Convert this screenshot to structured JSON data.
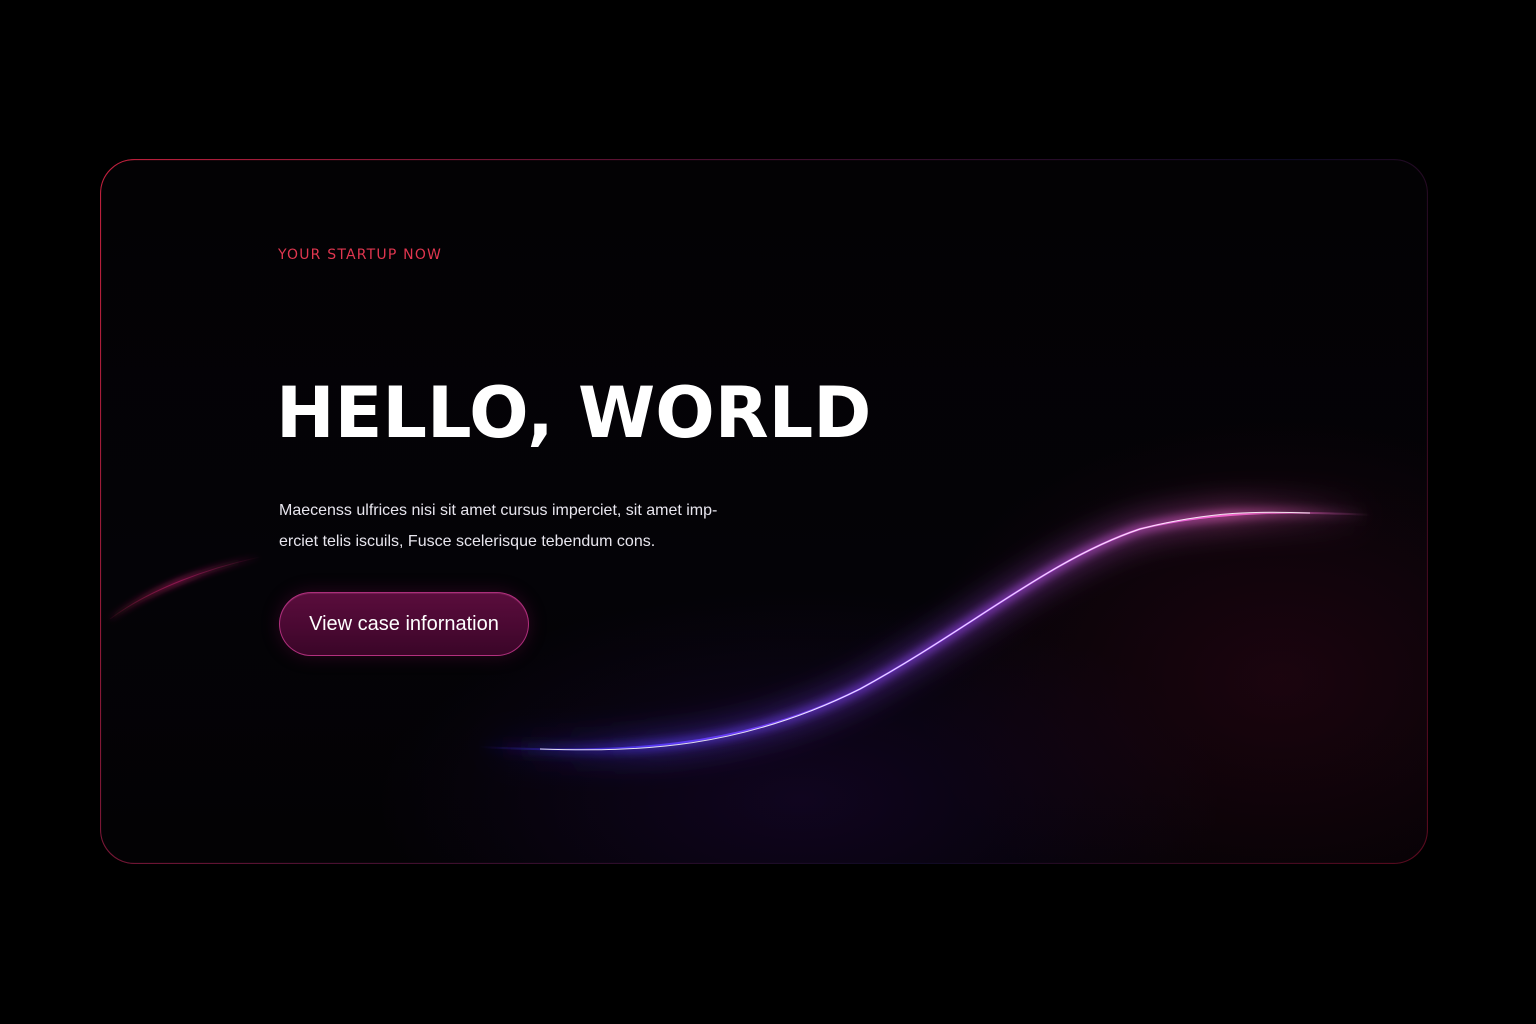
{
  "hero": {
    "eyebrow": "YOUR STARTUP NOW",
    "headline": "HELLO, WORLD",
    "body_line_1": "Maecenss ulfrices nisi sit amet cursus imperciet, sit amet imp-",
    "body_line_2": "erciet telis iscuils, Fusce scelerisque tebendum cons.",
    "cta_label": "View case infornation"
  },
  "colors": {
    "background": "#000000",
    "eyebrow": "#e0364f",
    "headline": "#ffffff",
    "button_fill": "#4a0832",
    "button_border": "#d23c96",
    "wave_start": "#5a3cff",
    "wave_end": "#ff6ad5"
  }
}
